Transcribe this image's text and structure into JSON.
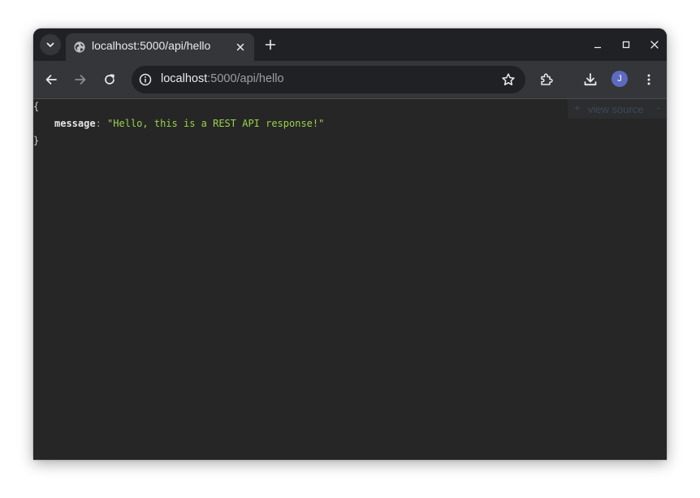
{
  "colors": {
    "frame": "#202124",
    "toolbar": "#35363a",
    "content_bg": "#262626",
    "json_key": "#e6e6e6",
    "json_string": "#9bd14b",
    "avatar": "#5c6bc0"
  },
  "tabstrip": {
    "tab_search_icon": "chevron-down-icon",
    "active_tab": {
      "favicon": "globe-icon",
      "title": "localhost:5000/api/hello",
      "close_icon": "close-icon"
    },
    "new_tab_icon": "plus-icon",
    "window_controls": [
      "minimize-icon",
      "maximize-icon",
      "close-icon"
    ]
  },
  "toolbar": {
    "back_icon": "arrow-left-icon",
    "forward_icon": "arrow-right-icon",
    "reload_icon": "reload-icon",
    "omnibox": {
      "info_icon": "info-icon",
      "host": "localhost",
      "path": ":5000/api/hello",
      "bookmark_icon": "star-icon"
    },
    "extensions_icon": "puzzle-icon",
    "downloads_icon": "download-icon",
    "profile_initial": "J",
    "menu_icon": "kebab-menu-icon"
  },
  "viewer": {
    "open_brace": "{",
    "close_brace": "}",
    "key": "message",
    "colon": ":",
    "value": "\"Hello, this is a REST API response!\"",
    "view_source": {
      "plus": "+",
      "label": "view source",
      "minus": "-"
    }
  }
}
